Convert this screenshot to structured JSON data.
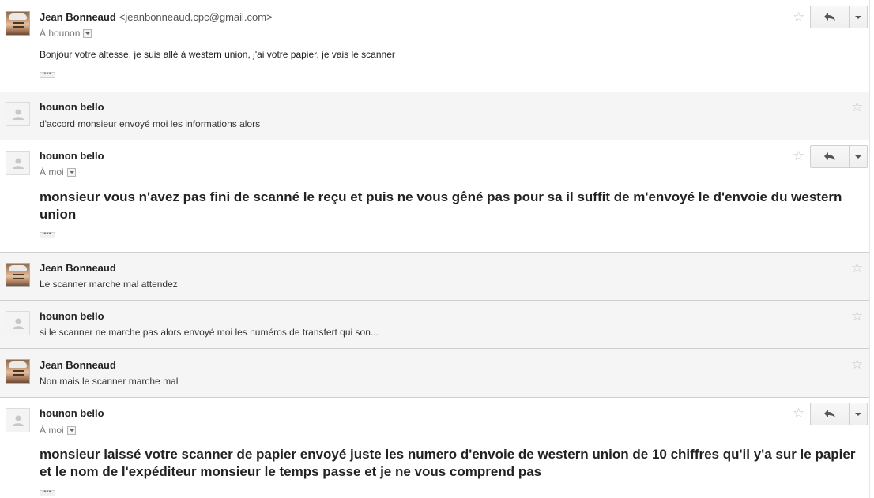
{
  "messages": [
    {
      "sender": "Jean Bonneaud",
      "email": "<jeanbonneaud.cpc@gmail.com>",
      "recipient": "À hounon",
      "body": "Bonjour votre altesse, je suis allé à western union, j'ai votre papier, je vais le scanner"
    },
    {
      "sender": "hounon bello",
      "snippet": "d'accord monsieur envoyé moi les informations alors"
    },
    {
      "sender": "hounon bello",
      "recipient": "À moi",
      "body": "monsieur vous n'avez pas fini de scanné le reçu et puis ne vous gêné pas pour sa il suffit de m'envoyé le d'envoie du western union"
    },
    {
      "sender": "Jean Bonneaud",
      "snippet": "Le scanner marche mal attendez"
    },
    {
      "sender": "hounon bello",
      "snippet": "si le scanner ne marche pas alors envoyé moi les numéros de transfert qui son..."
    },
    {
      "sender": "Jean Bonneaud",
      "snippet": "Non mais le scanner marche mal"
    },
    {
      "sender": "hounon bello",
      "recipient": "À moi",
      "body": "monsieur laissé votre scanner de papier envoyé juste les numero d'envoie de western union de 10 chiffres qu'il y'a sur le papier et le nom de l'expéditeur monsieur le temps passe et je ne vous comprend pas"
    }
  ],
  "icons": {
    "star": "☆",
    "ellipsis": "•••"
  }
}
